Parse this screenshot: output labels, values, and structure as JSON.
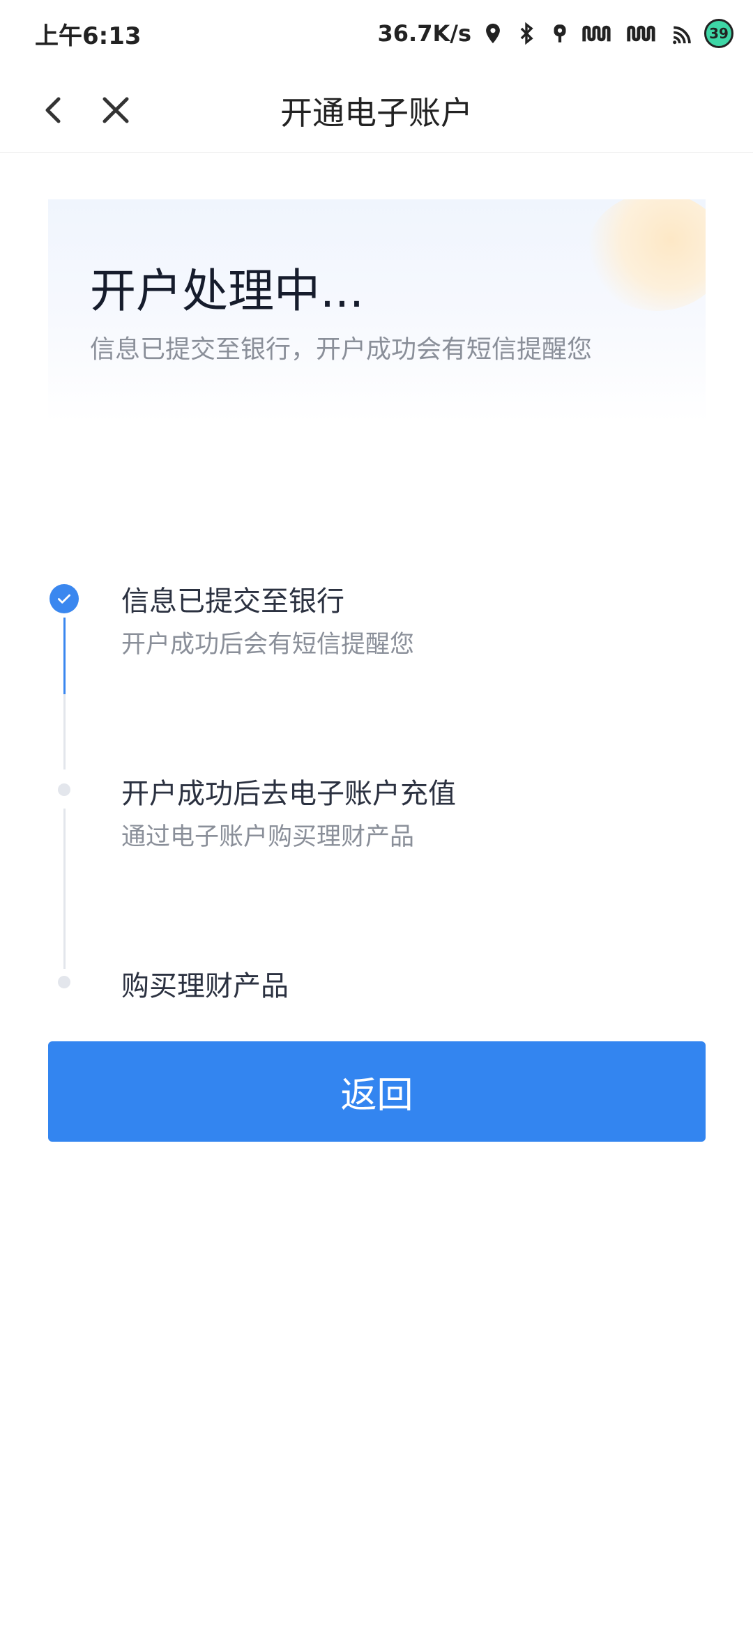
{
  "status_bar": {
    "time": "上午6:13",
    "net_speed": "36.7K/s",
    "battery": "39",
    "icons": [
      "location-icon",
      "bluetooth-icon",
      "vpn-key-icon",
      "signal-icon",
      "signal-icon",
      "wifi-icon",
      "battery-icon"
    ]
  },
  "nav": {
    "title": "开通电子账户",
    "back_icon": "chevron-left-icon",
    "close_icon": "close-icon"
  },
  "banner": {
    "title": "开户处理中...",
    "subtitle": "信息已提交至银行，开户成功会有短信提醒您"
  },
  "steps": [
    {
      "title": "信息已提交至银行",
      "subtitle": "开户成功后会有短信提醒您",
      "status": "done"
    },
    {
      "title": "开户成功后去电子账户充值",
      "subtitle": "通过电子账户购买理财产品",
      "status": "pending"
    },
    {
      "title": "购买理财产品",
      "subtitle": "",
      "status": "pending"
    }
  ],
  "actions": {
    "return_label": "返回"
  },
  "colors": {
    "accent": "#3385f0",
    "step_done": "#3a87ef",
    "step_pending": "#e3e6ec"
  }
}
